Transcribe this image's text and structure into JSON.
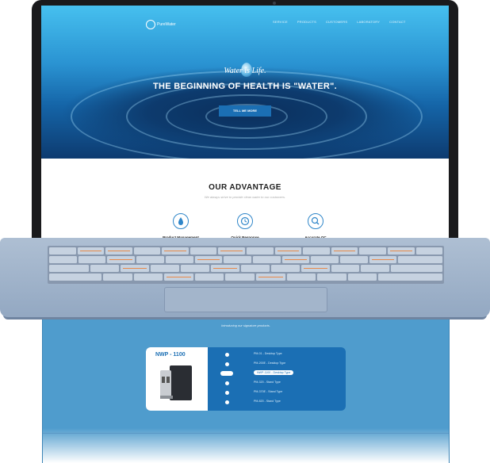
{
  "site": {
    "logo_text": "PureWater",
    "nav": [
      "SERVICE",
      "PRODUCTS",
      "CUSTOMERS",
      "LABORATORY",
      "CONTACT"
    ],
    "hero": {
      "tagline": "Water is Life.",
      "headline": "THE BEGINNING OF HEALTH IS \"WATER\".",
      "cta": "TELL ME MORE"
    },
    "advantage": {
      "title": "OUR ADVANTAGE",
      "subtitle": "We always strive to provide clean water to our customers.",
      "items": [
        {
          "label": "Product Management",
          "icon": "water-drop-icon"
        },
        {
          "label": "Quick Response",
          "icon": "clock-icon"
        },
        {
          "label": "Accurate QC",
          "icon": "magnifier-icon"
        }
      ]
    },
    "products": {
      "subtitle": "Introducing our signature products.",
      "model_name": "NWP - 1100",
      "models": [
        {
          "label": "PM-01 - Desktop Type",
          "active": false
        },
        {
          "label": "PM-200E - Desktop Type",
          "active": false
        },
        {
          "label": "NWP-1100 - Desktop Type",
          "active": true
        },
        {
          "label": "PM-320 - Stand Type",
          "active": false
        },
        {
          "label": "PM-370E - Stand Type",
          "active": false
        },
        {
          "label": "PM-820 - Stand Type",
          "active": false
        }
      ]
    }
  },
  "colors": {
    "accent": "#1b6fb4",
    "panel": "#4f9ccd",
    "laptop": "#aebfd3"
  }
}
